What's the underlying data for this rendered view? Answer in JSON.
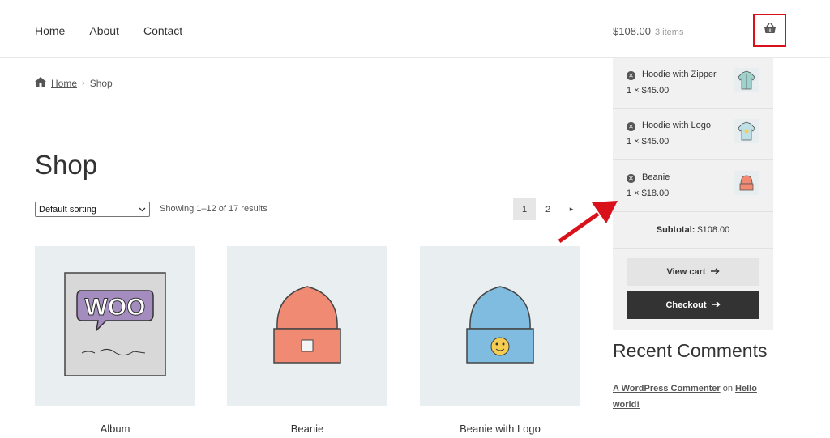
{
  "nav": {
    "items": [
      "Home",
      "About",
      "Contact"
    ]
  },
  "cart_summary": {
    "total": "$108.00",
    "count": "3 items"
  },
  "icons": {
    "cart": "basket-icon",
    "home": "home-icon",
    "remove": "remove-circle-icon",
    "arrow": "arrow-right-icon"
  },
  "breadcrumb": {
    "home": "Home",
    "separator": "›",
    "current": "Shop"
  },
  "page_title": "Shop",
  "sorting": {
    "selected": "Default sorting"
  },
  "results": "Showing 1–12 of 17 results",
  "pagination": {
    "pages": [
      "1",
      "2"
    ],
    "next": "▸"
  },
  "products": [
    {
      "title": "Album"
    },
    {
      "title": "Beanie"
    },
    {
      "title": "Beanie with Logo"
    }
  ],
  "mini_cart": {
    "items": [
      {
        "name": "Hoodie with Zipper",
        "qty_price": "1 × $45.00"
      },
      {
        "name": "Hoodie with Logo",
        "qty_price": "1 × $45.00"
      },
      {
        "name": "Beanie",
        "qty_price": "1 × $18.00"
      }
    ],
    "subtotal_label": "Subtotal:",
    "subtotal_value": "$108.00",
    "view_cart": "View cart",
    "checkout": "Checkout"
  },
  "recent_comments": {
    "title": "Recent Comments",
    "author": "A WordPress Commenter",
    "on": "on",
    "post": "Hello world!"
  },
  "colors": {
    "highlight": "#d9111b",
    "checkout_bg": "#333333",
    "thumb_bg": "#e9eef1"
  }
}
